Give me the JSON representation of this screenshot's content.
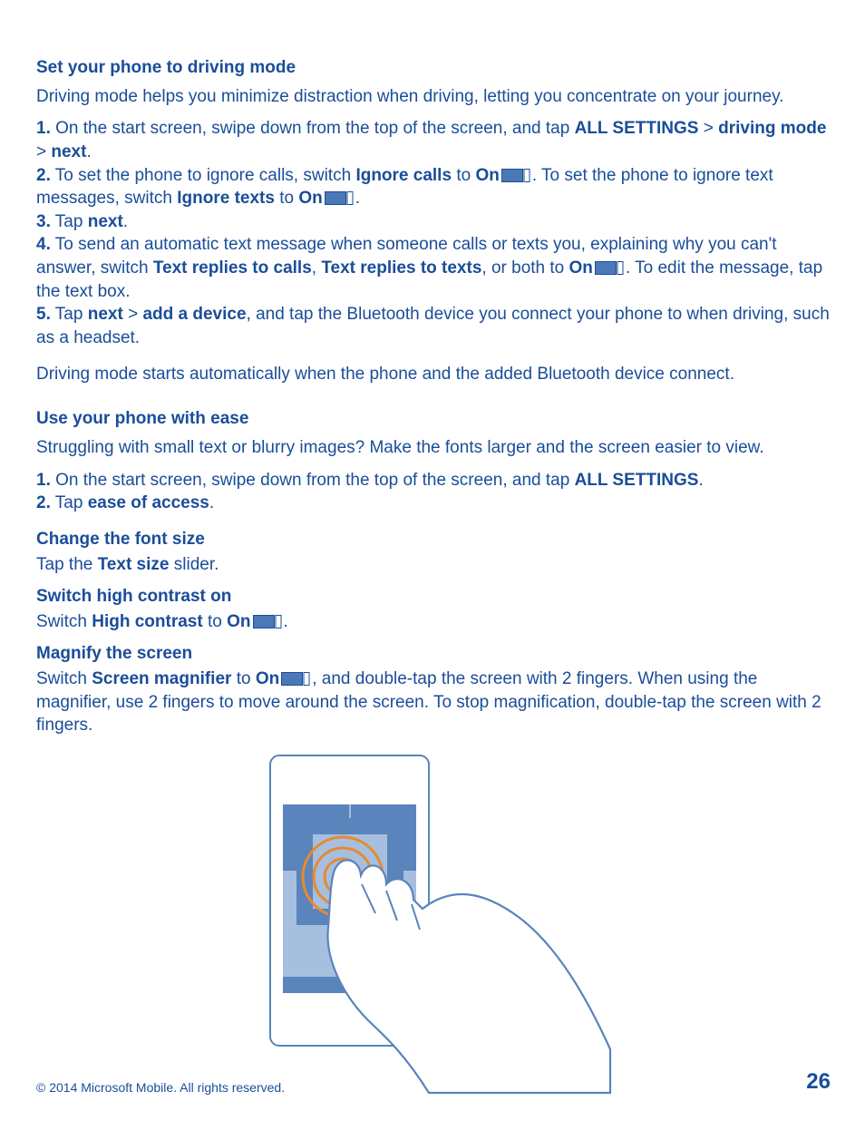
{
  "sec1": {
    "heading": "Set your phone to driving mode",
    "intro": "Driving mode helps you minimize distraction when driving, letting you concentrate on your journey.",
    "s1a": "1.",
    "s1b": " On the start screen, swipe down from the top of the screen, and tap ",
    "s1c": "ALL SETTINGS",
    "s1d": " > ",
    "s1e": "driving mode",
    "s1f": " > ",
    "s1g": "next",
    "s1h": ".",
    "s2a": "2.",
    "s2b": " To set the phone to ignore calls, switch ",
    "s2c": "Ignore calls",
    "s2d": " to ",
    "s2e": "On",
    "s2f": ". To set the phone to ignore text messages, switch ",
    "s2g": "Ignore texts",
    "s2h": " to ",
    "s2i": "On",
    "s2j": ".",
    "s3a": "3.",
    "s3b": " Tap ",
    "s3c": "next",
    "s3d": ".",
    "s4a": "4.",
    "s4b": " To send an automatic text message when someone calls or texts you, explaining why you can't answer, switch ",
    "s4c": "Text replies to calls",
    "s4d": ", ",
    "s4e": "Text replies to texts",
    "s4f": ", or both to ",
    "s4g": "On",
    "s4h": ". To edit the message, tap the text box.",
    "s5a": "5.",
    "s5b": " Tap ",
    "s5c": "next",
    "s5d": " > ",
    "s5e": "add a device",
    "s5f": ", and tap the Bluetooth device you connect your phone to when driving, such as a headset.",
    "outro": "Driving mode starts automatically when the phone and the added Bluetooth device connect."
  },
  "sec2": {
    "heading": "Use your phone with ease",
    "intro": "Struggling with small text or blurry images? Make the fonts larger and the screen easier to view.",
    "s1a": "1.",
    "s1b": " On the start screen, swipe down from the top of the screen, and tap ",
    "s1c": "ALL SETTINGS",
    "s1d": ".",
    "s2a": "2.",
    "s2b": " Tap ",
    "s2c": "ease of access",
    "s2d": "."
  },
  "sec3": {
    "heading": "Change the font size",
    "t1": "Tap the ",
    "t2": "Text size",
    "t3": " slider."
  },
  "sec4": {
    "heading": "Switch high contrast on",
    "t1": "Switch ",
    "t2": "High contrast",
    "t3": " to ",
    "t4": "On",
    "t5": "."
  },
  "sec5": {
    "heading": "Magnify the screen",
    "t1": "Switch ",
    "t2": "Screen magnifier",
    "t3": " to ",
    "t4": "On",
    "t5": ", and double-tap the screen with 2 fingers. When using the magnifier, use 2 fingers to move around the screen. To stop magnification, double-tap the screen with 2 fingers."
  },
  "footer": {
    "copyright": "© 2014 Microsoft Mobile. All rights reserved.",
    "page": "26"
  }
}
